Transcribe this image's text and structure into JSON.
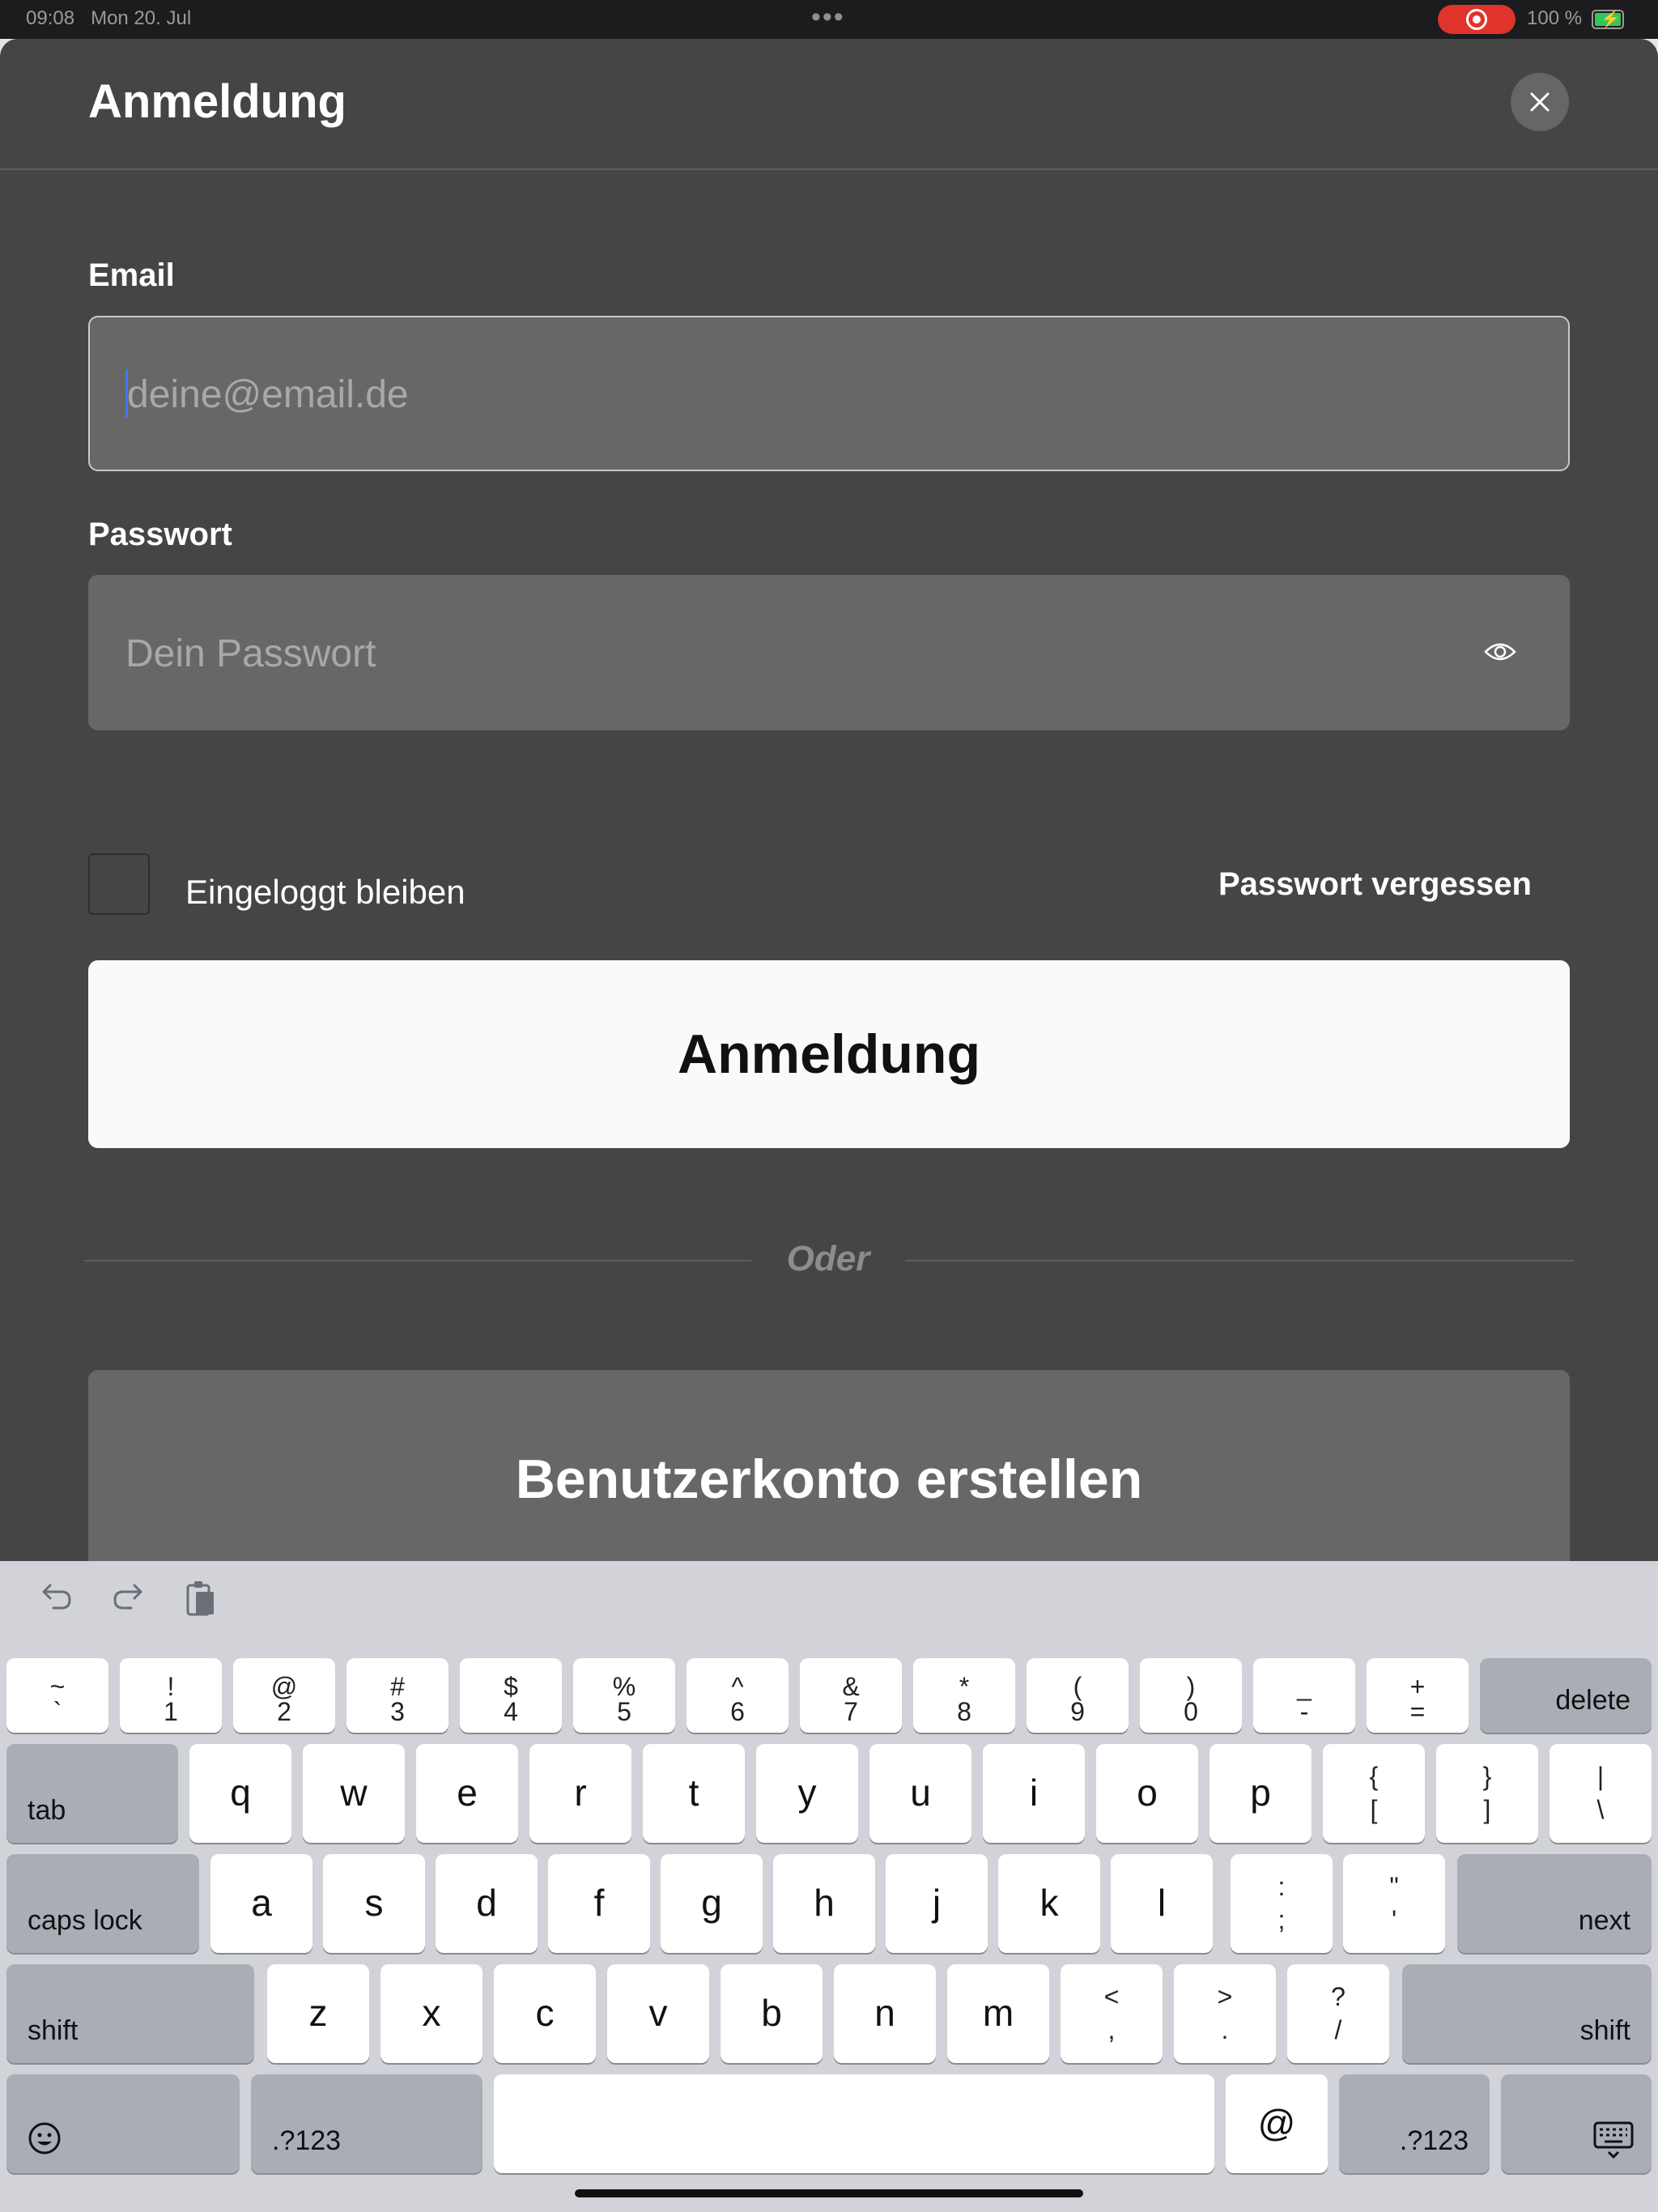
{
  "status_bar": {
    "time": "09:08",
    "date": "Mon 20. Jul",
    "battery": "100 %"
  },
  "sheet": {
    "title": "Anmeldung"
  },
  "form": {
    "email_label": "Email",
    "email_placeholder": "deine@email.de",
    "email_value": "",
    "password_label": "Passwort",
    "password_placeholder": "Dein Passwort",
    "password_value": "",
    "remember_label": "Eingeloggt bleiben",
    "remember_checked": false,
    "forgot_label": "Passwort vergessen",
    "submit_label": "Anmeldung",
    "divider_text": "Oder",
    "register_label": "Benutzerkonto erstellen"
  },
  "keyboard": {
    "toolbar": [
      "undo-icon",
      "redo-icon",
      "paste-icon"
    ],
    "row1": [
      {
        "top": "~",
        "bottom": "`"
      },
      {
        "top": "!",
        "bottom": "1"
      },
      {
        "top": "@",
        "bottom": "2"
      },
      {
        "top": "#",
        "bottom": "3"
      },
      {
        "top": "$",
        "bottom": "4"
      },
      {
        "top": "%",
        "bottom": "5"
      },
      {
        "top": "^",
        "bottom": "6"
      },
      {
        "top": "&",
        "bottom": "7"
      },
      {
        "top": "*",
        "bottom": "8"
      },
      {
        "top": "(",
        "bottom": "9"
      },
      {
        "top": ")",
        "bottom": "0"
      },
      {
        "top": "_",
        "bottom": "-"
      },
      {
        "top": "+",
        "bottom": "="
      }
    ],
    "delete": "delete",
    "tab": "tab",
    "row2": [
      "q",
      "w",
      "e",
      "r",
      "t",
      "y",
      "u",
      "i",
      "o",
      "p"
    ],
    "row2_sym": [
      {
        "top": "{",
        "bottom": "["
      },
      {
        "top": "}",
        "bottom": "]"
      },
      {
        "top": "|",
        "bottom": "\\"
      }
    ],
    "caps": "caps lock",
    "row3": [
      "a",
      "s",
      "d",
      "f",
      "g",
      "h",
      "j",
      "k",
      "l"
    ],
    "row3_sym": [
      {
        "top": ":",
        "bottom": ";"
      },
      {
        "top": "\"",
        "bottom": "'"
      }
    ],
    "next": "next",
    "shift": "shift",
    "row4": [
      "z",
      "x",
      "c",
      "v",
      "b",
      "n",
      "m"
    ],
    "row4_sym": [
      {
        "top": "<",
        "bottom": ","
      },
      {
        "top": ">",
        "bottom": "."
      },
      {
        "top": "?",
        "bottom": "/"
      }
    ],
    "numbers": ".?123",
    "at": "@"
  }
}
